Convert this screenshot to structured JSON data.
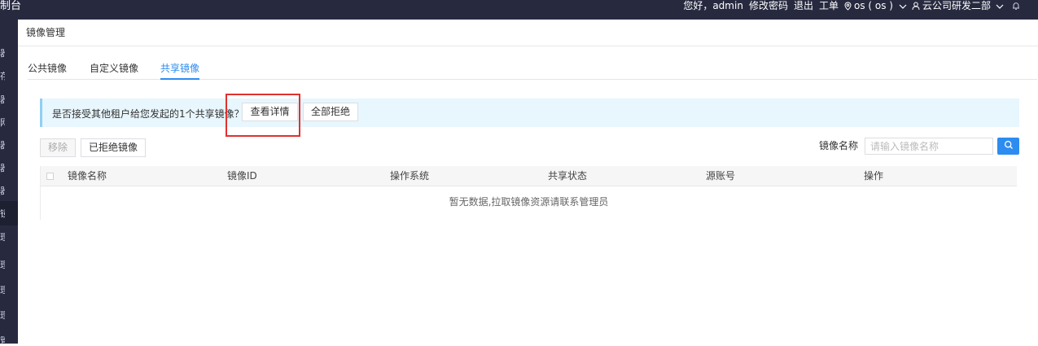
{
  "app": {
    "brand": "制台"
  },
  "topbar": {
    "greeting": "您好，admin",
    "change_password": "修改密码",
    "logout": "退出",
    "ticket": "工单",
    "region": "os ( os )",
    "org": "云公司研发二部",
    "icons": [
      "location-icon",
      "chevron-down-icon",
      "user-icon",
      "bell-icon"
    ]
  },
  "page": {
    "title": "镜像管理"
  },
  "tabs": [
    {
      "label": "公共镜像",
      "active": false
    },
    {
      "label": "自定义镜像",
      "active": false
    },
    {
      "label": "共享镜像",
      "active": true
    }
  ],
  "notice": {
    "message": "是否接受其他租户给您发起的1个共享镜像？",
    "view_detail": "查看详情",
    "reject_all": "全部拒绝"
  },
  "toolbar": {
    "remove": "移除",
    "rejected": "已拒绝镜像",
    "search_label": "镜像名称",
    "search_placeholder": "请输入镜像名称"
  },
  "table": {
    "columns": [
      "镜像名称",
      "镜像ID",
      "操作系统",
      "共享状态",
      "源账号",
      "操作"
    ],
    "empty_text": "暂无数据,拉取镜像资源请联系管理员"
  },
  "colors": {
    "accent": "#2d8cf0",
    "topbar": "#272a3f",
    "highlight": "#e0312e"
  }
}
